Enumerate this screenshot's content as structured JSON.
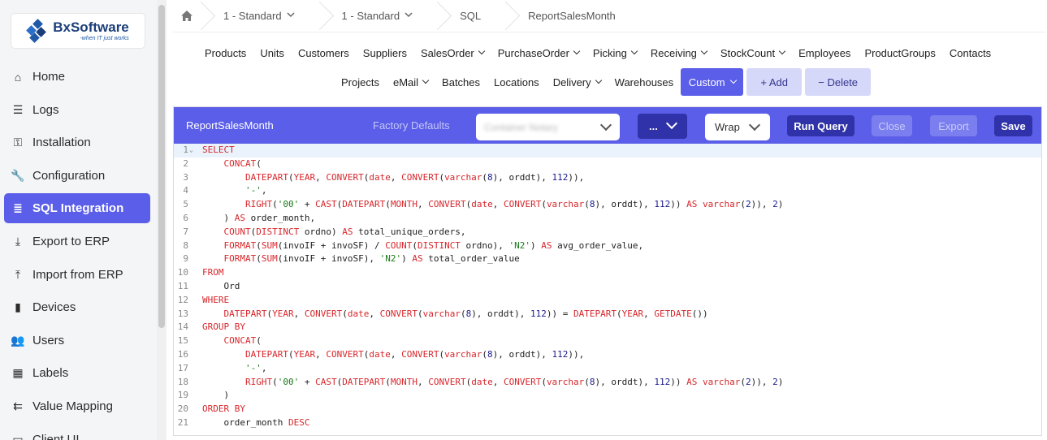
{
  "logo": {
    "name": "BxSoftware",
    "tagline": "-when IT just works"
  },
  "sidebar": {
    "items": [
      {
        "label": "Home",
        "icon": "home-icon",
        "glyph": "⌂"
      },
      {
        "label": "Logs",
        "icon": "list-icon",
        "glyph": "☰"
      },
      {
        "label": "Installation",
        "icon": "key-icon",
        "glyph": "⚿"
      },
      {
        "label": "Configuration",
        "icon": "wrench-icon",
        "glyph": "🔧"
      },
      {
        "label": "SQL Integration",
        "icon": "database-icon",
        "glyph": "≣",
        "active": true
      },
      {
        "label": "Export to ERP",
        "icon": "download-icon",
        "glyph": "⤓"
      },
      {
        "label": "Import from ERP",
        "icon": "upload-icon",
        "glyph": "⤒"
      },
      {
        "label": "Devices",
        "icon": "mobile-icon",
        "glyph": "▮"
      },
      {
        "label": "Users",
        "icon": "users-icon",
        "glyph": "👥"
      },
      {
        "label": "Labels",
        "icon": "barcode-icon",
        "glyph": "▦"
      },
      {
        "label": "Value Mapping",
        "icon": "merge-icon",
        "glyph": "⇇"
      },
      {
        "label": "Client UI",
        "icon": "window-icon",
        "glyph": "▭"
      }
    ]
  },
  "breadcrumb": {
    "items": [
      {
        "label": "1 - Standard",
        "dropdown": true
      },
      {
        "label": "1 - Standard",
        "dropdown": true
      },
      {
        "label": "SQL",
        "dropdown": false
      },
      {
        "label": "ReportSalesMonth",
        "dropdown": false
      }
    ]
  },
  "menu": {
    "row1": [
      {
        "label": "Products",
        "dropdown": false
      },
      {
        "label": "Units",
        "dropdown": false
      },
      {
        "label": "Customers",
        "dropdown": false
      },
      {
        "label": "Suppliers",
        "dropdown": false
      },
      {
        "label": "SalesOrder",
        "dropdown": true
      },
      {
        "label": "PurchaseOrder",
        "dropdown": true
      },
      {
        "label": "Picking",
        "dropdown": true
      },
      {
        "label": "Receiving",
        "dropdown": true
      },
      {
        "label": "StockCount",
        "dropdown": true
      },
      {
        "label": "Employees",
        "dropdown": false
      },
      {
        "label": "ProductGroups",
        "dropdown": false
      },
      {
        "label": "Contacts",
        "dropdown": false
      }
    ],
    "row2": [
      {
        "label": "Projects",
        "dropdown": false
      },
      {
        "label": "eMail",
        "dropdown": true
      },
      {
        "label": "Batches",
        "dropdown": false
      },
      {
        "label": "Locations",
        "dropdown": false
      },
      {
        "label": "Delivery",
        "dropdown": true
      },
      {
        "label": "Warehouses",
        "dropdown": false
      }
    ],
    "custom_label": "Custom",
    "add_label": "+ Add",
    "delete_label": "− Delete"
  },
  "editor": {
    "title": "ReportSalesMonth",
    "factory_defaults": "Factory Defaults",
    "connection_select": "Container Notary",
    "more_label": "...",
    "wrap_label": "Wrap",
    "run_label": "Run Query",
    "close_label": "Close",
    "export_label": "Export",
    "save_label": "Save",
    "lines": [
      "SELECT",
      "    CONCAT(",
      "        DATEPART(YEAR, CONVERT(date, CONVERT(varchar(8), orddt), 112)),",
      "        '-',",
      "        RIGHT('00' + CAST(DATEPART(MONTH, CONVERT(date, CONVERT(varchar(8), orddt), 112)) AS varchar(2)), 2)",
      "    ) AS order_month,",
      "    COUNT(DISTINCT ordno) AS total_unique_orders,",
      "    FORMAT(SUM(invoIF + invoSF) / COUNT(DISTINCT ordno), 'N2') AS avg_order_value,",
      "    FORMAT(SUM(invoIF + invoSF), 'N2') AS total_order_value",
      "FROM",
      "    Ord",
      "WHERE",
      "    DATEPART(YEAR, CONVERT(date, CONVERT(varchar(8), orddt), 112)) = DATEPART(YEAR, GETDATE())",
      "GROUP BY",
      "    CONCAT(",
      "        DATEPART(YEAR, CONVERT(date, CONVERT(varchar(8), orddt), 112)),",
      "        '-',",
      "        RIGHT('00' + CAST(DATEPART(MONTH, CONVERT(date, CONVERT(varchar(8), orddt), 112)) AS varchar(2)), 2)",
      "    )",
      "ORDER BY",
      "    order_month DESC"
    ]
  },
  "colors": {
    "accent": "#5b5ee8",
    "accent_dark": "#2f32a8",
    "keyword": "#d7262b",
    "string": "#1a7a1a"
  }
}
